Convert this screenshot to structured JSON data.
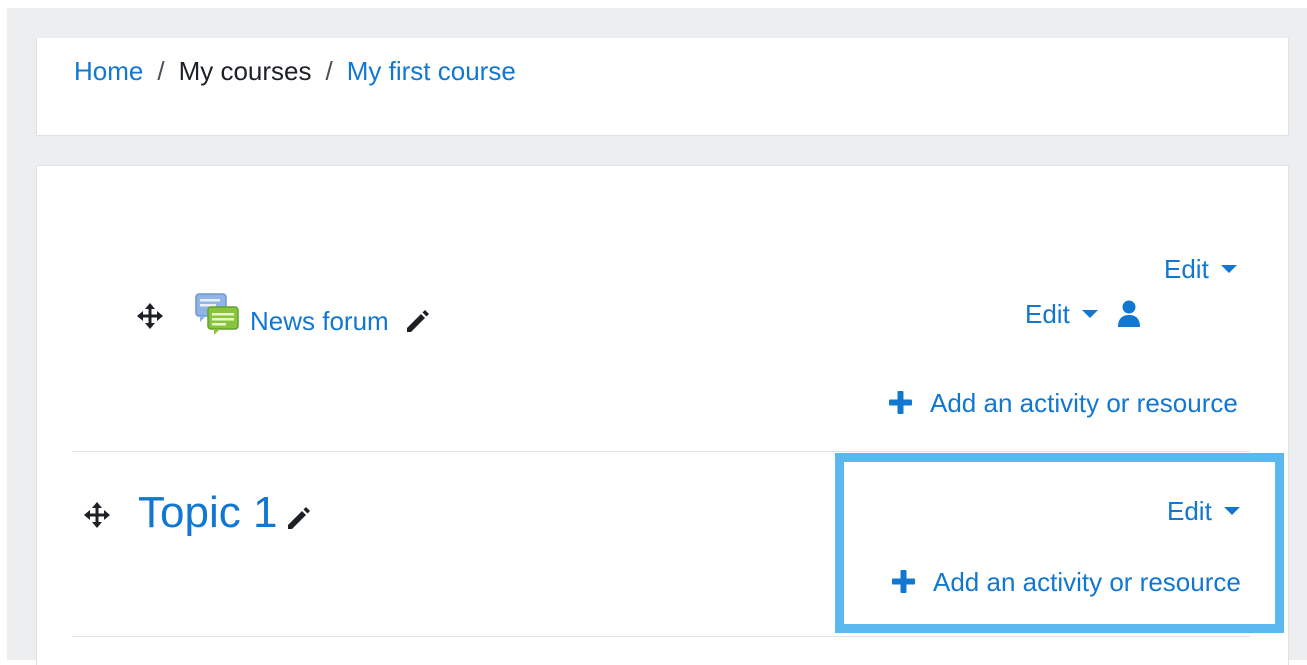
{
  "breadcrumb": {
    "home": "Home",
    "separator": "/",
    "my_courses": "My courses",
    "current_course": "My first course"
  },
  "general_section": {
    "edit_label": "Edit",
    "activity": {
      "name": "News forum",
      "icon": "forum-icon",
      "edit_label": "Edit",
      "role_icon": "user-icon"
    },
    "add_label": "Add an activity or resource"
  },
  "topic_section": {
    "title": "Topic 1",
    "edit_label": "Edit",
    "add_label": "Add an activity or resource"
  },
  "colors": {
    "link": "#1177d1",
    "highlight": "#5bb8ef",
    "background": "#edeef0"
  }
}
